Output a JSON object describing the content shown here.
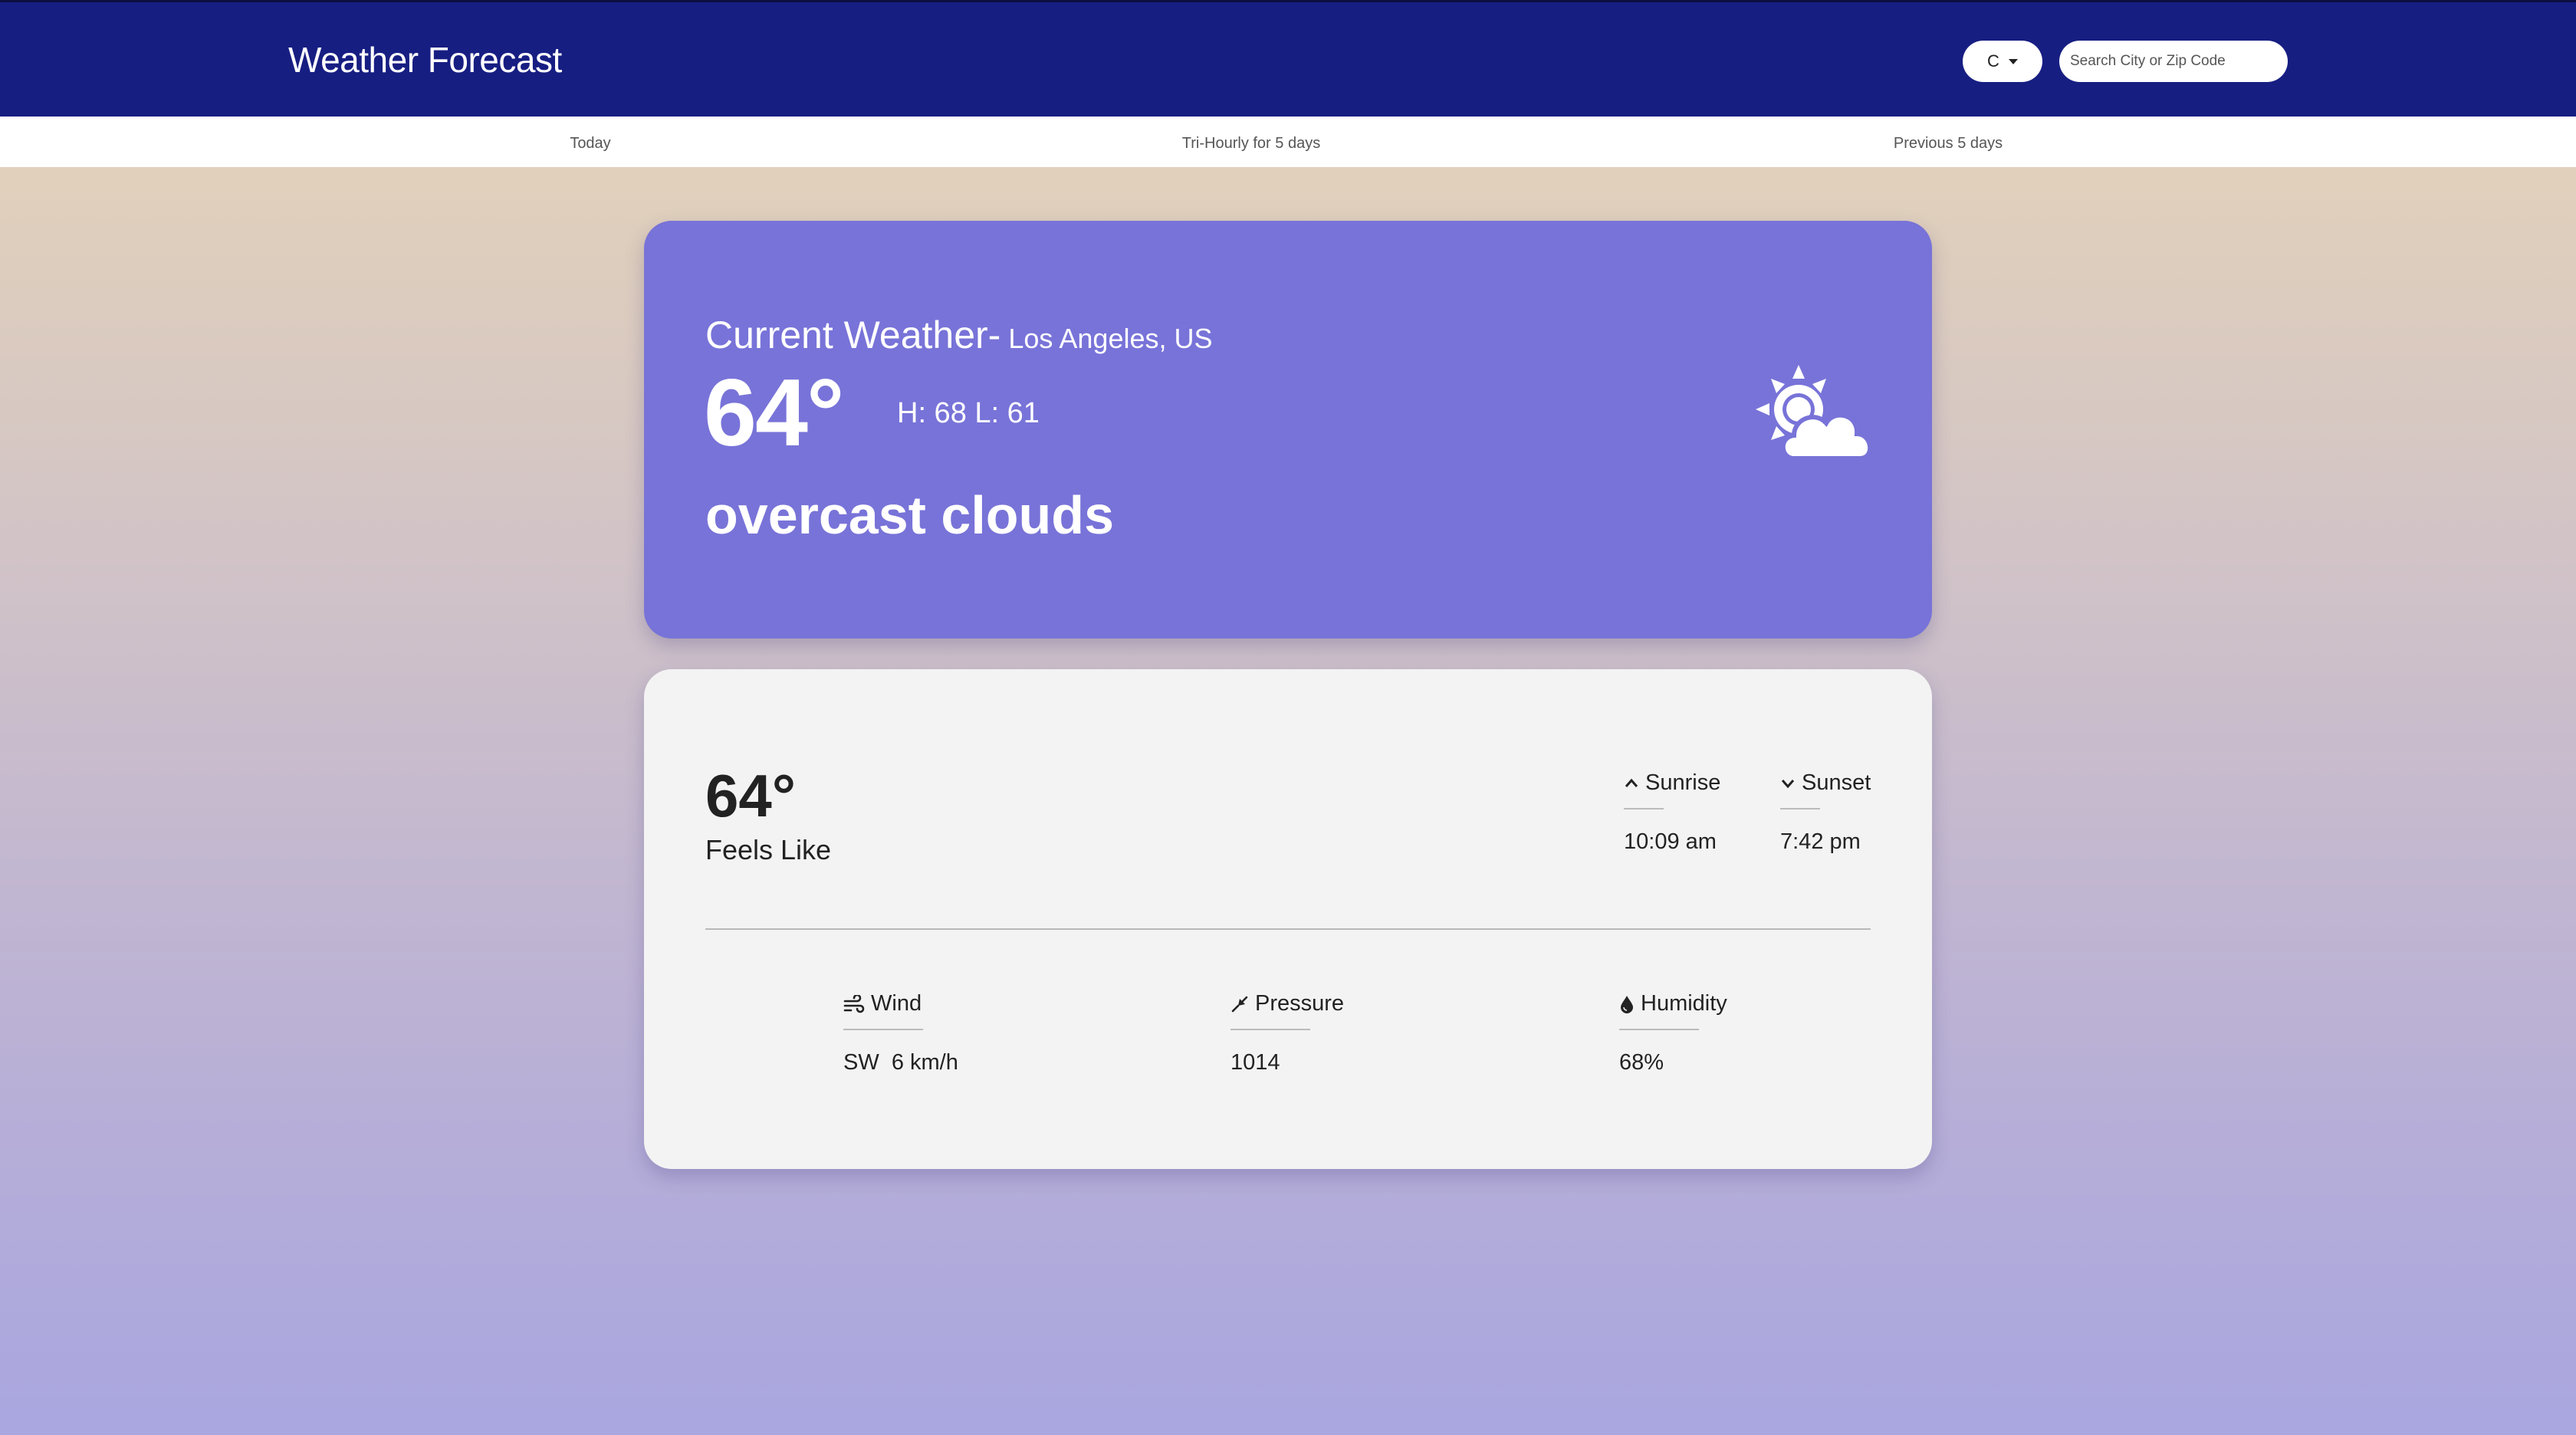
{
  "header": {
    "title": "Weather Forecast",
    "unit_label": "C",
    "search_placeholder": "Search City or Zip Code"
  },
  "nav": {
    "tabs": [
      {
        "label": "Today"
      },
      {
        "label": "Tri-Hourly for 5 days"
      },
      {
        "label": "Previous 5 days"
      }
    ]
  },
  "current": {
    "title": "Current Weather-",
    "location": "Los Angeles, US",
    "temp": "64°",
    "hilo": "H: 68 L: 61",
    "description": "overcast clouds",
    "icon": "partly-cloudy-icon"
  },
  "details": {
    "feels_temp": "64°",
    "feels_label": "Feels Like",
    "sunrise": {
      "label": "Sunrise",
      "value": "10:09 am",
      "icon": "chevron-up-icon"
    },
    "sunset": {
      "label": "Sunset",
      "value": "7:42 pm",
      "icon": "chevron-down-icon"
    },
    "wind": {
      "label": "Wind",
      "direction": "SW",
      "value": "6 km/h",
      "icon": "wind-icon"
    },
    "pressure": {
      "label": "Pressure",
      "value": "1014",
      "icon": "compress-icon"
    },
    "humidity": {
      "label": "Humidity",
      "value": "68%",
      "icon": "droplet-icon"
    }
  },
  "colors": {
    "header_bg": "#171e82",
    "current_card_bg": "#7873d8",
    "details_card_bg": "#f3f3f3"
  }
}
